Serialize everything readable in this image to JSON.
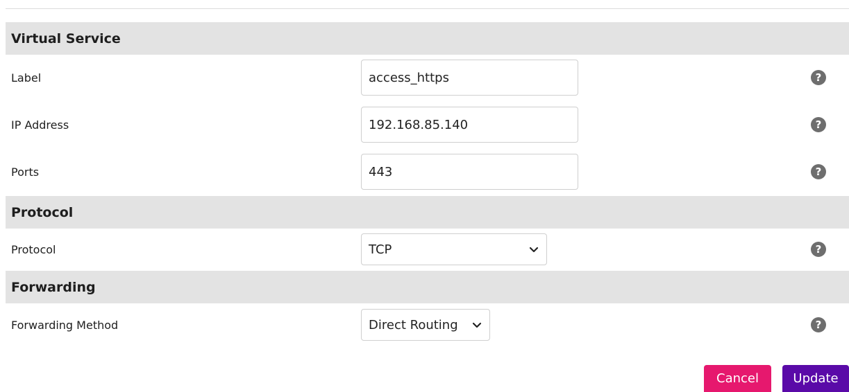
{
  "sections": {
    "virtual_service": "Virtual Service",
    "protocol": "Protocol",
    "forwarding": "Forwarding"
  },
  "fields": {
    "label": {
      "label": "Label",
      "value": "access_https"
    },
    "ip_address": {
      "label": "IP Address",
      "value": "192.168.85.140"
    },
    "ports": {
      "label": "Ports",
      "value": "443"
    },
    "protocol": {
      "label": "Protocol",
      "selected": "TCP"
    },
    "forwarding_method": {
      "label": "Forwarding Method",
      "selected": "Direct Routing"
    }
  },
  "help": {
    "glyph": "?"
  },
  "buttons": {
    "cancel": "Cancel",
    "update": "Update"
  },
  "colors": {
    "section_bg": "#e3e3e3",
    "help_icon": "#6e6e6e",
    "cancel": "#e6186e",
    "update": "#5a0aa8"
  },
  "icons": {
    "help": "question-circle-icon",
    "dropdown": "chevron-down-icon"
  }
}
